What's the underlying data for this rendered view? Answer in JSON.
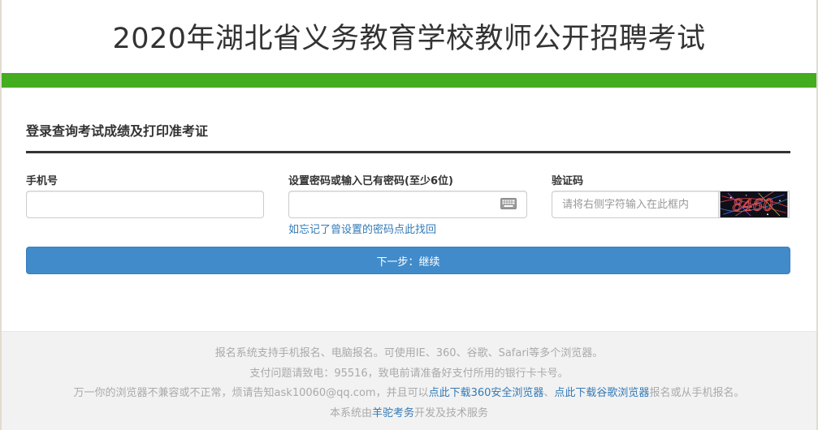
{
  "header": {
    "title": "2020年湖北省义务教育学校教师公开招聘考试"
  },
  "colors": {
    "brand_green": "#44ac1f",
    "button_blue": "#428bca",
    "link_blue": "#337ab7"
  },
  "login": {
    "title": "登录查询考试成绩及打印准考证",
    "phone_label": "手机号",
    "phone_value": "",
    "password_label": "设置密码或输入已有密码(至少6位)",
    "password_value": "",
    "forgot_link": "如忘记了曾设置的密码点此找回",
    "captcha_label": "验证码",
    "captcha_placeholder": "请将右侧字符输入在此框内",
    "captcha_value": "",
    "captcha_text": "8460",
    "next_button": "下一步：继续"
  },
  "icons": {
    "keyboard": "keyboard-icon"
  },
  "footer": {
    "line1": "报名系统支持手机报名、电脑报名。可使用IE、360、谷歌、Safari等多个浏览器。",
    "line2": "支付问题请致电：95516，致电前请准备好支付所用的银行卡卡号。",
    "line3_prefix": "万一你的浏览器不兼容或不正常，烦请告知ask10060@qq.com，并且可以",
    "line3_link1": "点此下载360安全浏览器",
    "line3_sep": "、",
    "line3_link2": "点此下载谷歌浏览器",
    "line3_suffix": "报名或从手机报名。",
    "line4_prefix": "本系统由",
    "line4_link": "羊驼考务",
    "line4_suffix": "开发及技术服务"
  }
}
